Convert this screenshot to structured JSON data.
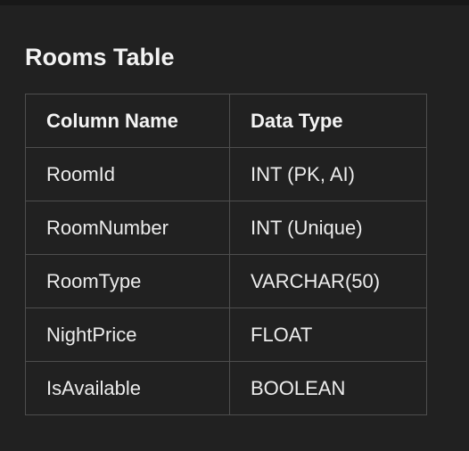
{
  "title": "Rooms Table",
  "table": {
    "headers": [
      "Column Name",
      "Data Type"
    ],
    "rows": [
      [
        "RoomId",
        "INT (PK, AI)"
      ],
      [
        "RoomNumber",
        "INT (Unique)"
      ],
      [
        "RoomType",
        "VARCHAR(50)"
      ],
      [
        "NightPrice",
        "FLOAT"
      ],
      [
        "IsAvailable",
        "BOOLEAN"
      ]
    ]
  },
  "colors": {
    "background": "#212121",
    "text": "#ececec",
    "border": "#4e4e4e"
  }
}
